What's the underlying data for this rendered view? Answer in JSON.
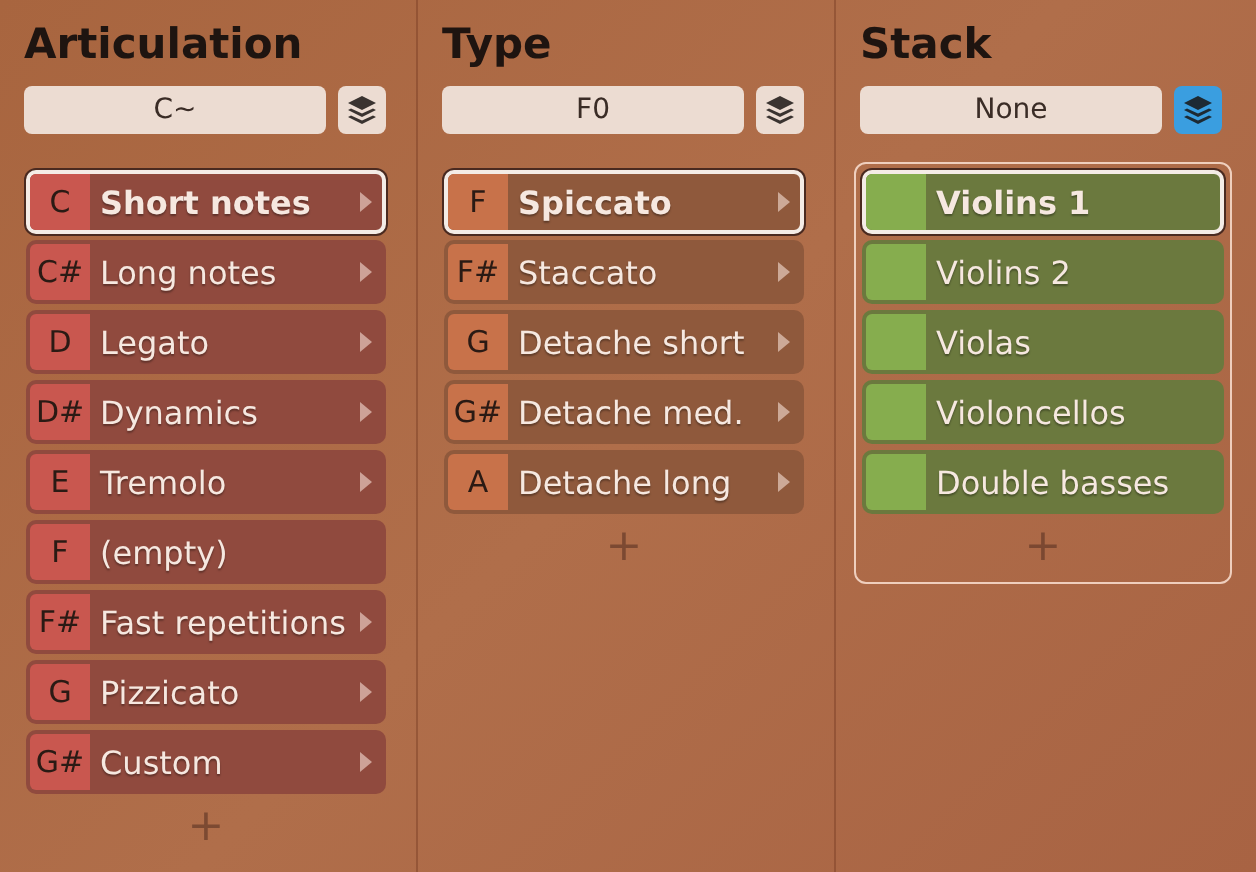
{
  "columns": [
    {
      "title": "Articulation",
      "field_value": "C~",
      "stack_on": false,
      "framed": false,
      "color": "#c9574f",
      "items": [
        {
          "key": "C",
          "label": "Short notes",
          "arrow": true,
          "selected": true
        },
        {
          "key": "C#",
          "label": "Long notes",
          "arrow": true,
          "selected": false
        },
        {
          "key": "D",
          "label": "Legato",
          "arrow": true,
          "selected": false
        },
        {
          "key": "D#",
          "label": "Dynamics",
          "arrow": true,
          "selected": false
        },
        {
          "key": "E",
          "label": "Tremolo",
          "arrow": true,
          "selected": false
        },
        {
          "key": "F",
          "label": "(empty)",
          "arrow": false,
          "selected": false
        },
        {
          "key": "F#",
          "label": "Fast repetitions",
          "arrow": true,
          "selected": false
        },
        {
          "key": "G",
          "label": "Pizzicato",
          "arrow": true,
          "selected": false
        },
        {
          "key": "G#",
          "label": "Custom",
          "arrow": true,
          "selected": false
        }
      ],
      "add": "+"
    },
    {
      "title": "Type",
      "field_value": "F0",
      "stack_on": false,
      "framed": false,
      "color": "#c8724a",
      "items": [
        {
          "key": "F",
          "label": "Spiccato",
          "arrow": true,
          "selected": true
        },
        {
          "key": "F#",
          "label": "Staccato",
          "arrow": true,
          "selected": false
        },
        {
          "key": "G",
          "label": "Detache short",
          "arrow": true,
          "selected": false
        },
        {
          "key": "G#",
          "label": "Detache med.",
          "arrow": true,
          "selected": false
        },
        {
          "key": "A",
          "label": "Detache long",
          "arrow": true,
          "selected": false
        }
      ],
      "add": "+"
    },
    {
      "title": "Stack",
      "field_value": "None",
      "stack_on": true,
      "framed": true,
      "color": "#86ad4e",
      "items": [
        {
          "label": "Violins 1",
          "arrow": false,
          "selected": true
        },
        {
          "label": "Violins 2",
          "arrow": false,
          "selected": false
        },
        {
          "label": "Violas",
          "arrow": false,
          "selected": false
        },
        {
          "label": "Violoncellos",
          "arrow": false,
          "selected": false
        },
        {
          "label": "Double basses",
          "arrow": false,
          "selected": false
        }
      ],
      "add": "+"
    }
  ]
}
